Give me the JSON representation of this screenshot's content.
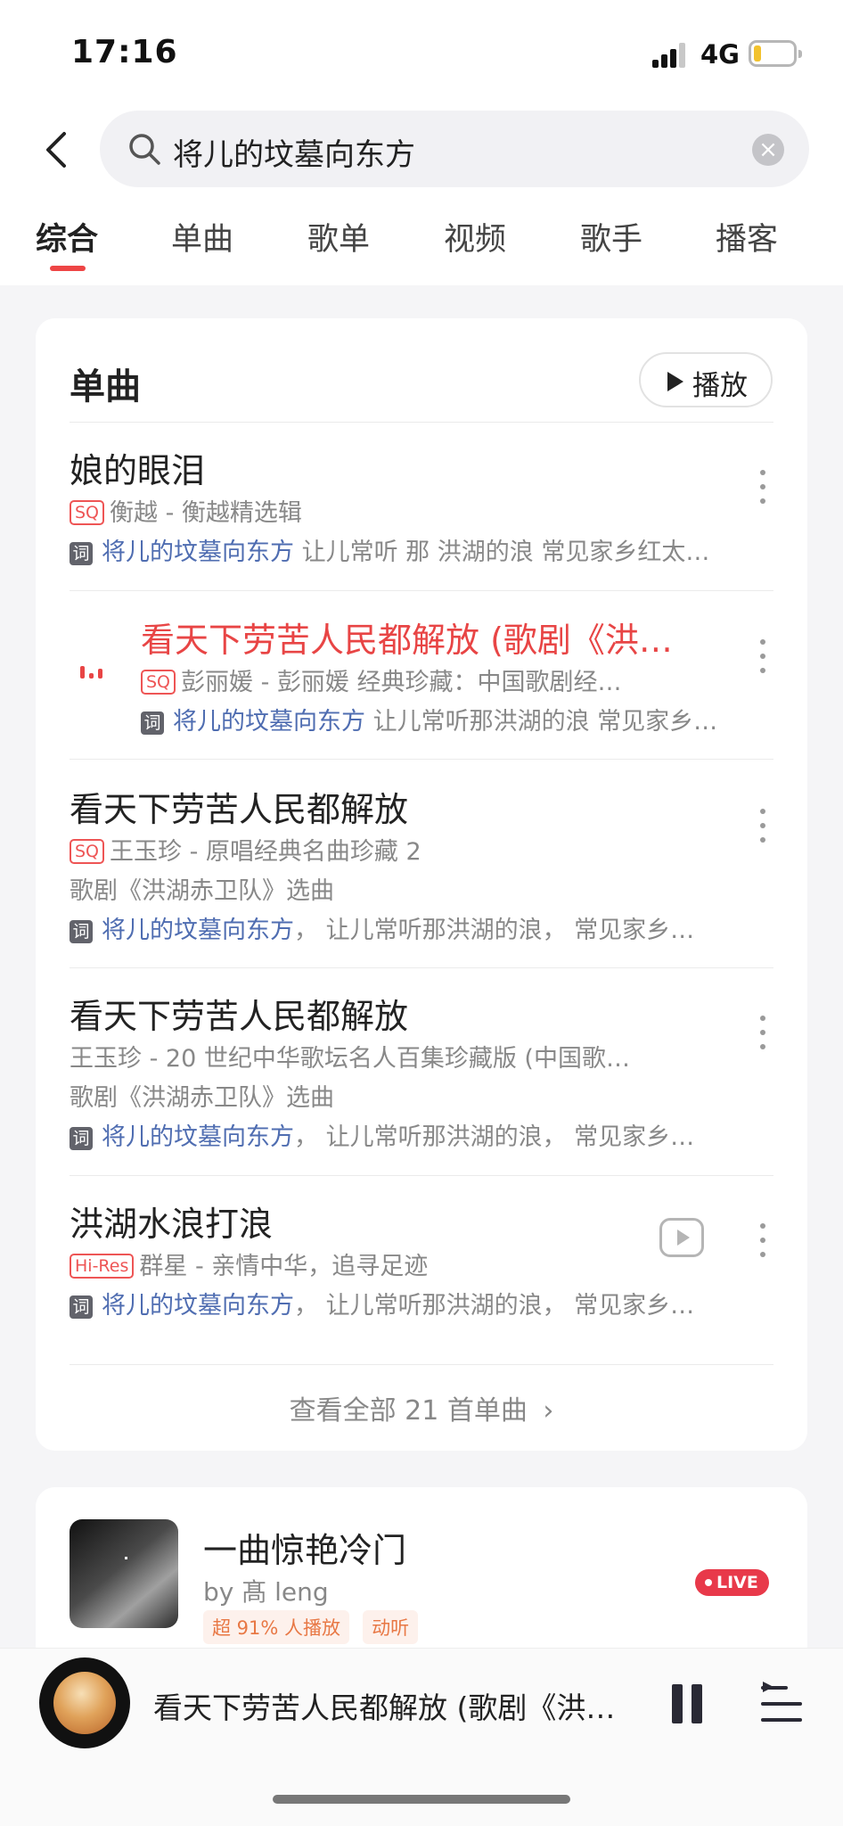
{
  "status_bar": {
    "time": "17:16",
    "network": "4G"
  },
  "search": {
    "query": "将儿的坟墓向东方",
    "clear": "×"
  },
  "tabs": [
    "综合",
    "单曲",
    "歌单",
    "视频",
    "歌手",
    "播客"
  ],
  "songs_section": {
    "title": "单曲",
    "play_all": "播放",
    "songs": [
      {
        "title": "娘的眼泪",
        "badge": "SQ",
        "meta": "衡越 - 衡越精选辑",
        "lyric_tag": "词",
        "lyric_keyword": "将儿的坟墓向东方",
        "lyric_rest": " 让儿常听 那 洪湖的浪 常见家乡红太…"
      },
      {
        "title": "看天下劳苦人民都解放 (歌剧《洪…",
        "badge": "SQ",
        "meta": "彭丽媛 - 彭丽媛 经典珍藏：中国歌剧经…",
        "lyric_tag": "词",
        "lyric_keyword": "将儿的坟墓向东方",
        "lyric_rest": " 让儿常听那洪湖的浪 常见家乡…"
      },
      {
        "title": "看天下劳苦人民都解放",
        "badge": "SQ",
        "meta": "王玉珍 - 原唱经典名曲珍藏 2",
        "subtitle": "歌剧《洪湖赤卫队》选曲",
        "lyric_tag": "词",
        "lyric_keyword": "将儿的坟墓向东方",
        "lyric_rest": "， 让儿常听那洪湖的浪， 常见家乡…"
      },
      {
        "title": "看天下劳苦人民都解放",
        "meta": "王玉珍 - 20 世纪中华歌坛名人百集珍藏版 (中国歌…",
        "subtitle": "歌剧《洪湖赤卫队》选曲",
        "lyric_tag": "词",
        "lyric_keyword": "将儿的坟墓向东方",
        "lyric_rest": "， 让儿常听那洪湖的浪， 常见家乡…"
      },
      {
        "title": "洪湖水浪打浪",
        "badge": "Hi-Res",
        "meta": "群星 - 亲情中华，追寻足迹",
        "lyric_tag": "词",
        "lyric_keyword": "将儿的坟墓向东方",
        "lyric_rest": "， 让儿常听那洪湖的浪， 常见家乡…"
      }
    ],
    "view_all": "查看全部 21 首单曲",
    "view_all_chevron": "›"
  },
  "playlist": {
    "title": "一曲惊艳冷门",
    "by": "by 髙 leng",
    "tags": [
      "超 91% 人播放",
      "动听"
    ],
    "live": "LIVE"
  },
  "now_playing": {
    "title": "看天下劳苦人民都解放 (歌剧《洪湖赤卫队》选曲)"
  },
  "colors": {
    "accent": "#ee4545",
    "keyword": "#4f6db1",
    "live": "#e8394a",
    "tag_text": "#e87845"
  }
}
